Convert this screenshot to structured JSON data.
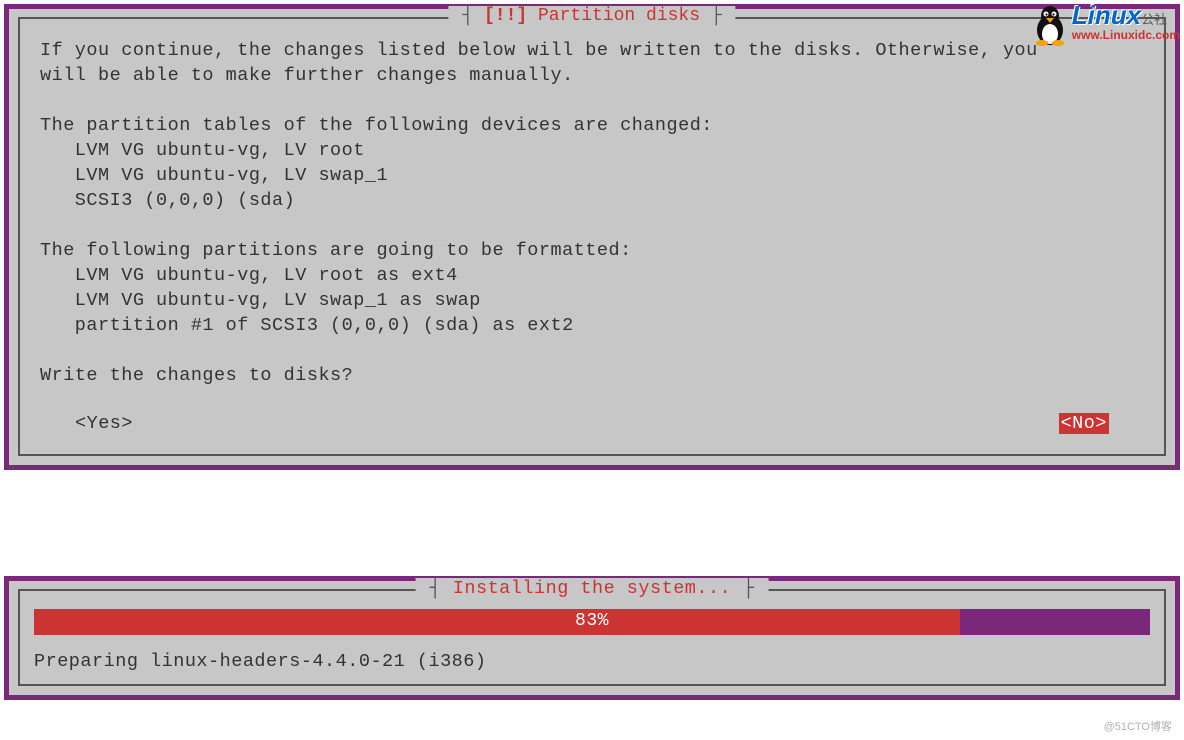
{
  "watermark": {
    "brand": "Linux",
    "brand_cn": "公社",
    "url": "www.Linuxidc.com"
  },
  "dialog": {
    "title_prefix": "[!!]",
    "title_text": "Partition disks",
    "body": "If you continue, the changes listed below will be written to the disks. Otherwise, you\nwill be able to make further changes manually.\n\nThe partition tables of the following devices are changed:\n   LVM VG ubuntu-vg, LV root\n   LVM VG ubuntu-vg, LV swap_1\n   SCSI3 (0,0,0) (sda)\n\nThe following partitions are going to be formatted:\n   LVM VG ubuntu-vg, LV root as ext4\n   LVM VG ubuntu-vg, LV swap_1 as swap\n   partition #1 of SCSI3 (0,0,0) (sda) as ext2\n\nWrite the changes to disks?",
    "yes_label": "<Yes>",
    "no_label": "<No>"
  },
  "progress": {
    "title": "Installing the system...",
    "percent": 83,
    "percent_label": "83%",
    "status": "Preparing linux-headers-4.4.0-21 (i386)"
  },
  "footer": "@51CTO博客"
}
